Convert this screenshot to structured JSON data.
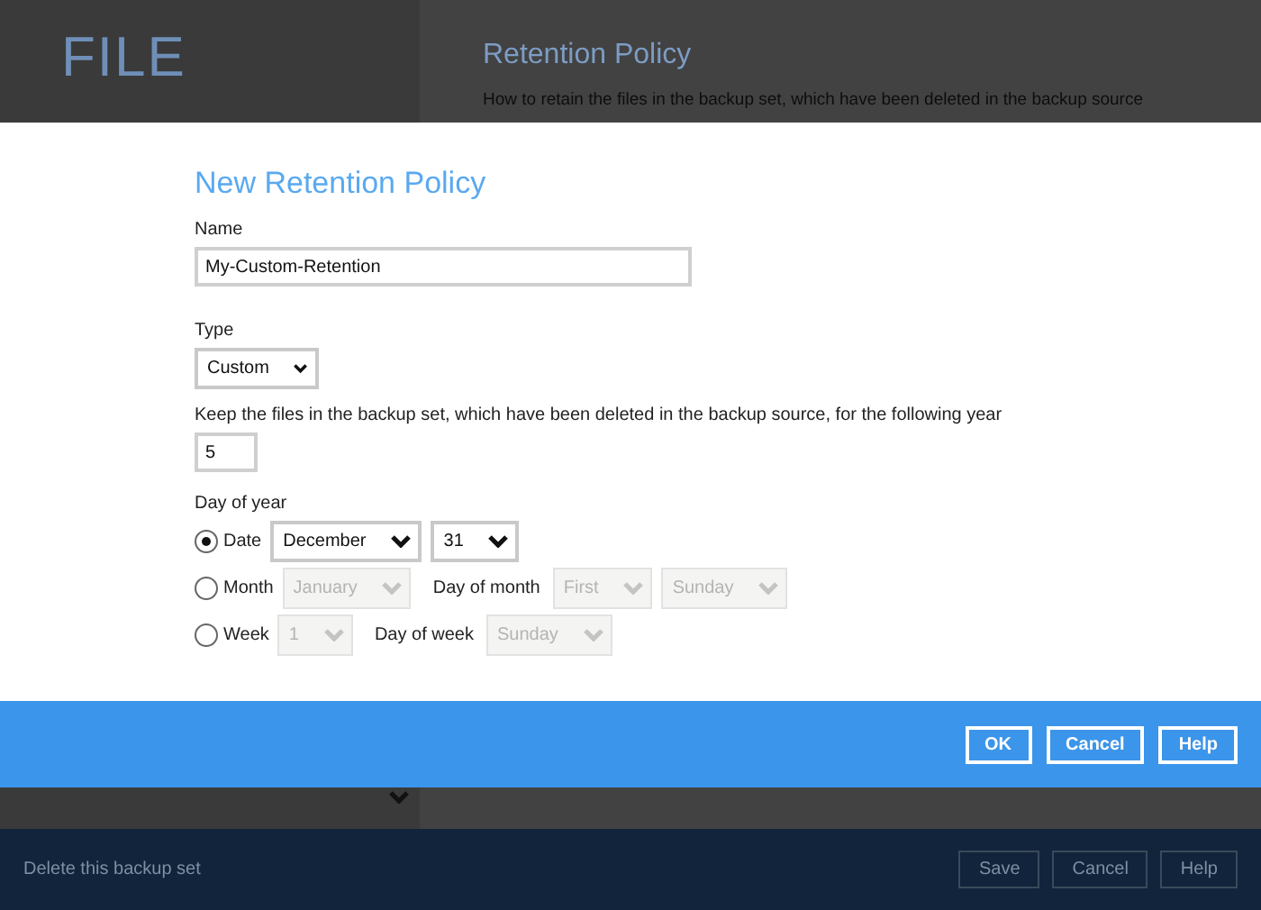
{
  "background": {
    "app_title": "FILE",
    "section_title": "Retention Policy",
    "section_description": "How to retain the files in the backup set, which have been deleted in the backup source",
    "footer_link": "Delete this backup set",
    "footer_buttons": [
      "Save",
      "Cancel",
      "Help"
    ]
  },
  "dialog": {
    "title": "New Retention Policy",
    "name_label": "Name",
    "name_value": "My-Custom-Retention",
    "type_label": "Type",
    "type_value": "Custom",
    "keep_label": "Keep the files in the backup set, which have been deleted in the backup source, for the following year",
    "keep_value": "5",
    "day_of_year_label": "Day of year",
    "options": [
      {
        "label": "Date",
        "selected": true,
        "fields": [
          {
            "kind": "select",
            "value": "December",
            "disabled": false
          },
          {
            "kind": "select",
            "value": "31",
            "disabled": false
          }
        ]
      },
      {
        "label": "Month",
        "selected": false,
        "fields": [
          {
            "kind": "select",
            "value": "January",
            "disabled": true
          },
          {
            "kind": "label",
            "value": "Day of month"
          },
          {
            "kind": "select",
            "value": "First",
            "disabled": true
          },
          {
            "kind": "select",
            "value": "Sunday",
            "disabled": true
          }
        ]
      },
      {
        "label": "Week",
        "selected": false,
        "fields": [
          {
            "kind": "select",
            "value": "1",
            "disabled": true
          },
          {
            "kind": "label",
            "value": "Day of week"
          },
          {
            "kind": "select",
            "value": "Sunday",
            "disabled": true
          }
        ]
      }
    ],
    "buttons": [
      "OK",
      "Cancel",
      "Help"
    ]
  }
}
